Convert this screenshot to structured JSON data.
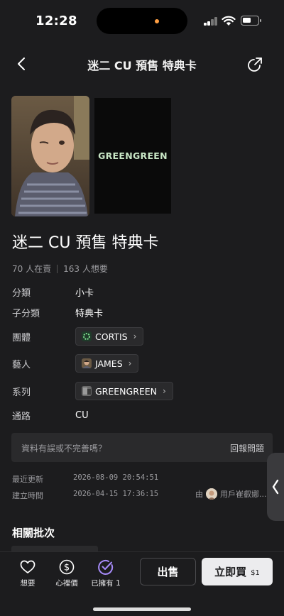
{
  "status": {
    "time": "12:28"
  },
  "nav": {
    "title": "迷二 CU 預售 特典卡"
  },
  "images": {
    "brand_text": "GREENGREEN"
  },
  "item": {
    "title": "迷二 CU 預售 特典卡",
    "sellers": "70 人在賣",
    "wanters": "163 人想要"
  },
  "attributes": {
    "category_label": "分類",
    "category": "小卡",
    "subcategory_label": "子分類",
    "subcategory": "特典卡",
    "group_label": "團體",
    "group": "CORTIS",
    "artist_label": "藝人",
    "artist": "JAMES",
    "series_label": "系列",
    "series": "GREENGREEN",
    "channel_label": "通路",
    "channel": "CU"
  },
  "report": {
    "question": "資料有誤或不完善嗎？",
    "link": "回報問題"
  },
  "meta": {
    "updated_label": "最近更新",
    "updated": "2026-08-09 20:54:51",
    "created_label": "建立時間",
    "created": "2026-04-15 17:36:15",
    "creator_prefix": "由",
    "creator": "用戶崔叡娜..."
  },
  "related": {
    "title": "相關批次"
  },
  "bottom": {
    "want_label": "想要",
    "price_label": "心裡價",
    "owned_label": "已擁有 1",
    "sell_label": "出售",
    "buy_label": "立即買",
    "buy_price": "$1"
  },
  "colors": {
    "accent_purple": "#a78bfa",
    "brand_green": "#c8e6c5"
  }
}
